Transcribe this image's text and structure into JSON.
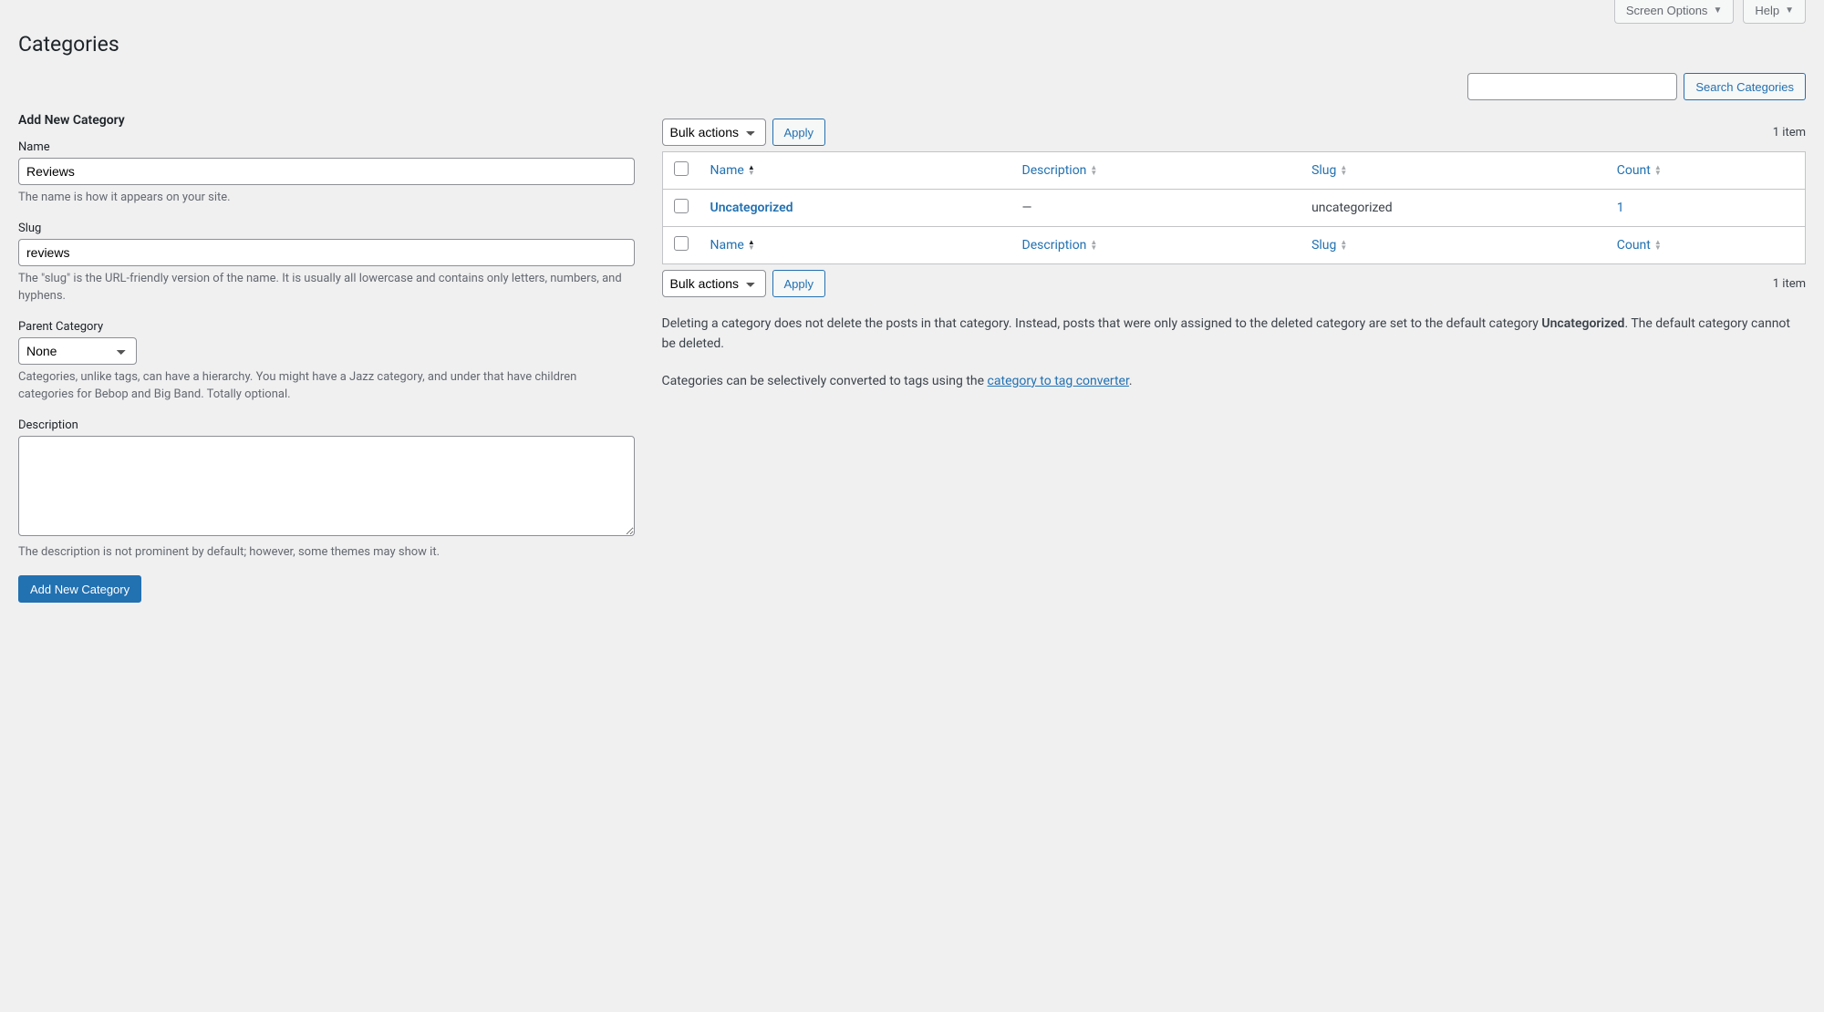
{
  "top": {
    "screen_options": "Screen Options",
    "help": "Help"
  },
  "page_title": "Categories",
  "search": {
    "button": "Search Categories"
  },
  "form": {
    "heading": "Add New Category",
    "name": {
      "label": "Name",
      "value": "Reviews",
      "help": "The name is how it appears on your site."
    },
    "slug": {
      "label": "Slug",
      "value": "reviews",
      "help": "The \"slug\" is the URL-friendly version of the name. It is usually all lowercase and contains only letters, numbers, and hyphens."
    },
    "parent": {
      "label": "Parent Category",
      "selected": "None",
      "help": "Categories, unlike tags, can have a hierarchy. You might have a Jazz category, and under that have children categories for Bebop and Big Band. Totally optional."
    },
    "description": {
      "label": "Description",
      "value": "",
      "help": "The description is not prominent by default; however, some themes may show it."
    },
    "submit": "Add New Category"
  },
  "list": {
    "bulk_label": "Bulk actions",
    "apply": "Apply",
    "item_count": "1 item",
    "columns": {
      "name": "Name",
      "description": "Description",
      "slug": "Slug",
      "count": "Count"
    },
    "rows": [
      {
        "name": "Uncategorized",
        "description": "—",
        "slug": "uncategorized",
        "count": "1"
      }
    ]
  },
  "info": {
    "p1_a": "Deleting a category does not delete the posts in that category. Instead, posts that were only assigned to the deleted category are set to the default category ",
    "p1_strong": "Uncategorized",
    "p1_b": ". The default category cannot be deleted.",
    "p2_a": "Categories can be selectively converted to tags using the ",
    "p2_link": "category to tag converter",
    "p2_b": "."
  }
}
